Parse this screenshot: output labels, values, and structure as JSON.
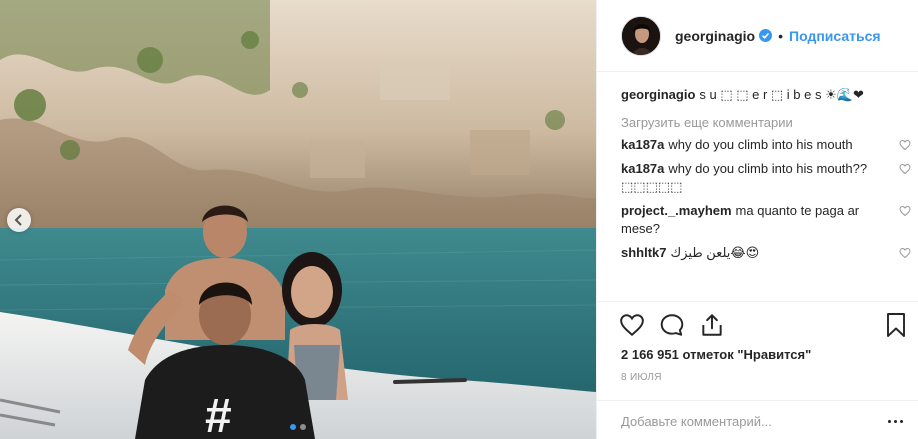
{
  "post": {
    "photo_alt": "Photo",
    "carousel_count": 2,
    "active_index": 0
  },
  "header": {
    "username": "georginagio",
    "separator": "•",
    "follow_label": "Подписаться"
  },
  "caption": {
    "username": "georginagio",
    "text": "s u ⬚ ⬚ e r ⬚ i b e s ☀🌊❤"
  },
  "load_more_label": "Загрузить еще комментарии",
  "comments": [
    {
      "username": "ka187a",
      "text": "why do you climb into his mouth"
    },
    {
      "username": "ka187a",
      "text": "why do you climb into his mouth??⬚⬚⬚⬚⬚"
    },
    {
      "username": "project._.mayhem",
      "text": "ma quanto te paga ar mese?"
    },
    {
      "username": "shhltk7",
      "text": "يلعن طيزك😂😍"
    }
  ],
  "likes_text": "2 166 951 отметок \"Нравится\"",
  "date_text": "8 июля",
  "comment_input": {
    "placeholder": "Добавьте комментарий...",
    "value": ""
  },
  "colors": {
    "accent": "#3897f0",
    "muted": "#999999",
    "text": "#262626",
    "border": "#efefef"
  },
  "icons": {
    "like": "heart-outline",
    "comment": "speech-bubble",
    "share": "share-arrow",
    "save": "bookmark",
    "more": "three-dots",
    "prev": "chevron-left"
  }
}
